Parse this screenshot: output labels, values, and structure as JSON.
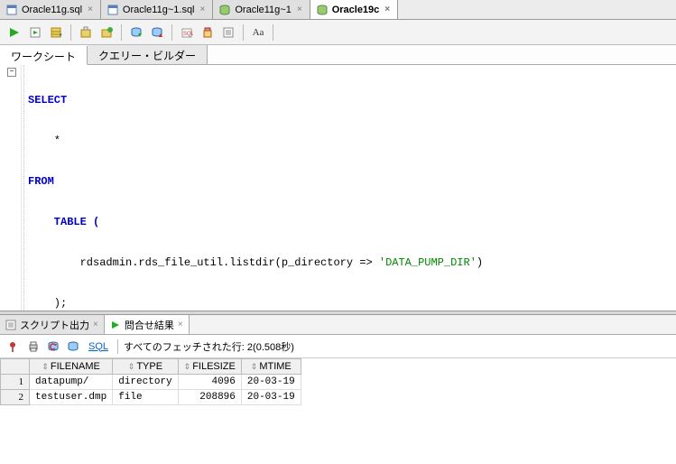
{
  "tabs": [
    {
      "label": "Oracle11g.sql",
      "icon": "sql",
      "active": false
    },
    {
      "label": "Oracle11g~1.sql",
      "icon": "sql",
      "active": false
    },
    {
      "label": "Oracle11g~1",
      "icon": "db",
      "active": false
    },
    {
      "label": "Oracle19c",
      "icon": "db",
      "active": true
    }
  ],
  "subtabs": {
    "worksheet": "ワークシート",
    "query_builder": "クエリー・ビルダー"
  },
  "sql": {
    "select": "SELECT",
    "star": "    *",
    "from": "FROM",
    "table_open": "    TABLE (",
    "func": "        rdsadmin.rds_file_util.listdir(p_directory => ",
    "str": "'DATA_PUMP_DIR'",
    "func_end": ")",
    "table_close": "    );"
  },
  "bottom_tabs": {
    "script_output": "スクリプト出力",
    "query_result": "問合せ結果"
  },
  "result_toolbar": {
    "sql_label": "SQL",
    "status": "すべてのフェッチされた行: 2(0.508秒)"
  },
  "grid": {
    "columns": [
      "FILENAME",
      "TYPE",
      "FILESIZE",
      "MTIME"
    ],
    "rows": [
      {
        "n": "1",
        "filename": "datapump/",
        "type": "directory",
        "filesize": "4096",
        "mtime": "20-03-19"
      },
      {
        "n": "2",
        "filename": "testuser.dmp",
        "type": "file",
        "filesize": "208896",
        "mtime": "20-03-19"
      }
    ]
  }
}
